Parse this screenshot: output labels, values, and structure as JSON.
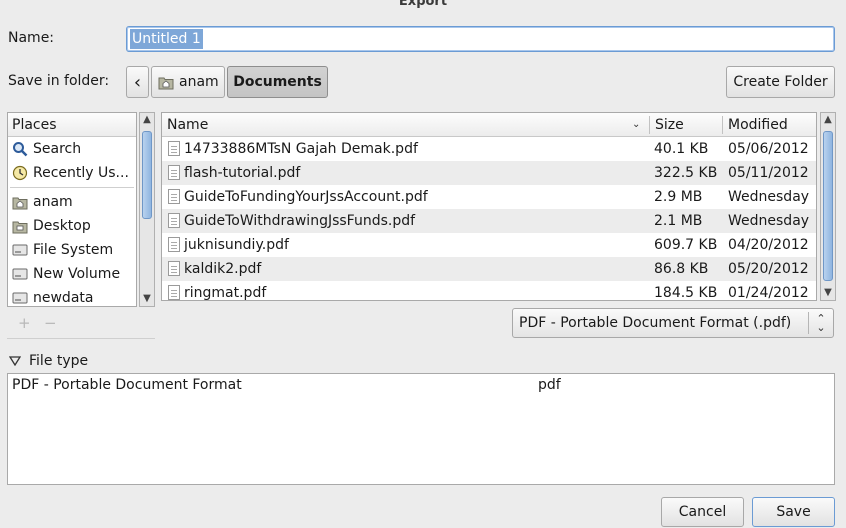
{
  "window": {
    "title": "Export"
  },
  "name_field": {
    "label": "Name:",
    "value": "Untitled 1"
  },
  "folder": {
    "label": "Save in folder:",
    "back_glyph": "‹",
    "path": [
      "anam",
      "Documents"
    ]
  },
  "create_folder_label": "Create Folder",
  "places": {
    "header": "Places",
    "items": [
      {
        "label": "Search",
        "icon": "search-icon"
      },
      {
        "label": "Recently Us...",
        "icon": "clock-icon"
      },
      {
        "label": "anam",
        "icon": "home-folder-icon"
      },
      {
        "label": "Desktop",
        "icon": "desktop-folder-icon"
      },
      {
        "label": "File System",
        "icon": "drive-icon"
      },
      {
        "label": "New Volume",
        "icon": "drive-icon"
      },
      {
        "label": "newdata",
        "icon": "drive-icon"
      }
    ],
    "add_glyph": "+",
    "remove_glyph": "−"
  },
  "files": {
    "columns": {
      "name": "Name",
      "size": "Size",
      "modified": "Modified"
    },
    "rows": [
      {
        "name": "14733886MTsN Gajah Demak.pdf",
        "size": "40.1 KB",
        "modified": "05/06/2012"
      },
      {
        "name": "flash-tutorial.pdf",
        "size": "322.5 KB",
        "modified": "05/11/2012"
      },
      {
        "name": "GuideToFundingYourJssAccount.pdf",
        "size": "2.9 MB",
        "modified": "Wednesday"
      },
      {
        "name": "GuideToWithdrawingJssFunds.pdf",
        "size": "2.1 MB",
        "modified": "Wednesday"
      },
      {
        "name": "juknisundiy.pdf",
        "size": "609.7 KB",
        "modified": "04/20/2012"
      },
      {
        "name": "kaldik2.pdf",
        "size": "86.8 KB",
        "modified": "05/20/2012"
      },
      {
        "name": "ringmat.pdf",
        "size": "184.5 KB",
        "modified": "01/24/2012"
      }
    ]
  },
  "filter": {
    "selected": "PDF - Portable Document Format (.pdf)"
  },
  "file_type": {
    "label": "File type",
    "rows": [
      {
        "name": "PDF - Portable Document Format",
        "ext": "pdf"
      }
    ]
  },
  "buttons": {
    "cancel": "Cancel",
    "save": "Save"
  },
  "colors": {
    "selection": "#7ea7d8",
    "focus_border": "#6b9bd4",
    "scroll_thumb": "#8fb5e0"
  }
}
